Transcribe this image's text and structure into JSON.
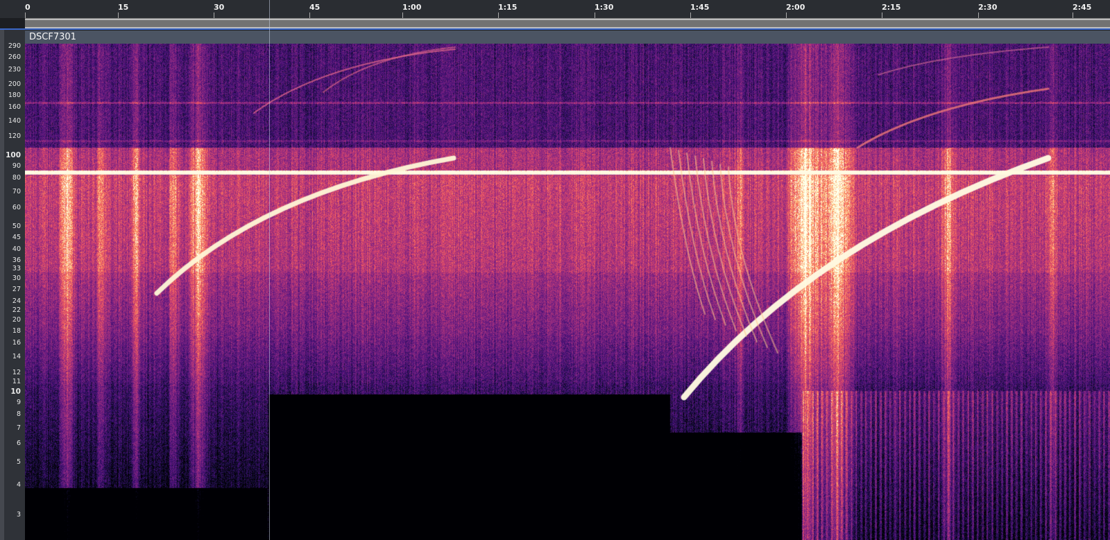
{
  "timeline": {
    "ticks": [
      "0",
      "15",
      "30",
      "45",
      "1:00",
      "1:15",
      "1:30",
      "1:45",
      "2:00",
      "2:15",
      "2:30",
      "2:45"
    ]
  },
  "track": {
    "name": "DSCF7301"
  },
  "frequency_axis": {
    "labels": [
      "290",
      "260",
      "230",
      "200",
      "180",
      "160",
      "140",
      "120",
      "100",
      "90",
      "80",
      "70",
      "60",
      "50",
      "45",
      "40",
      "36",
      "33",
      "30",
      "27",
      "24",
      "22",
      "20",
      "18",
      "16",
      "14",
      "12",
      "11",
      "10",
      "9",
      "8",
      "7",
      "6",
      "5",
      "4",
      "3"
    ],
    "bold_labels": [
      "100",
      "10"
    ]
  },
  "colors": {
    "timeline_bg": "#2a2d32",
    "track_header_bg": "#4b5463",
    "selection_line": "#3a67c8"
  },
  "icons": {
    "scrollbar": "horizontal-scrollbar"
  }
}
